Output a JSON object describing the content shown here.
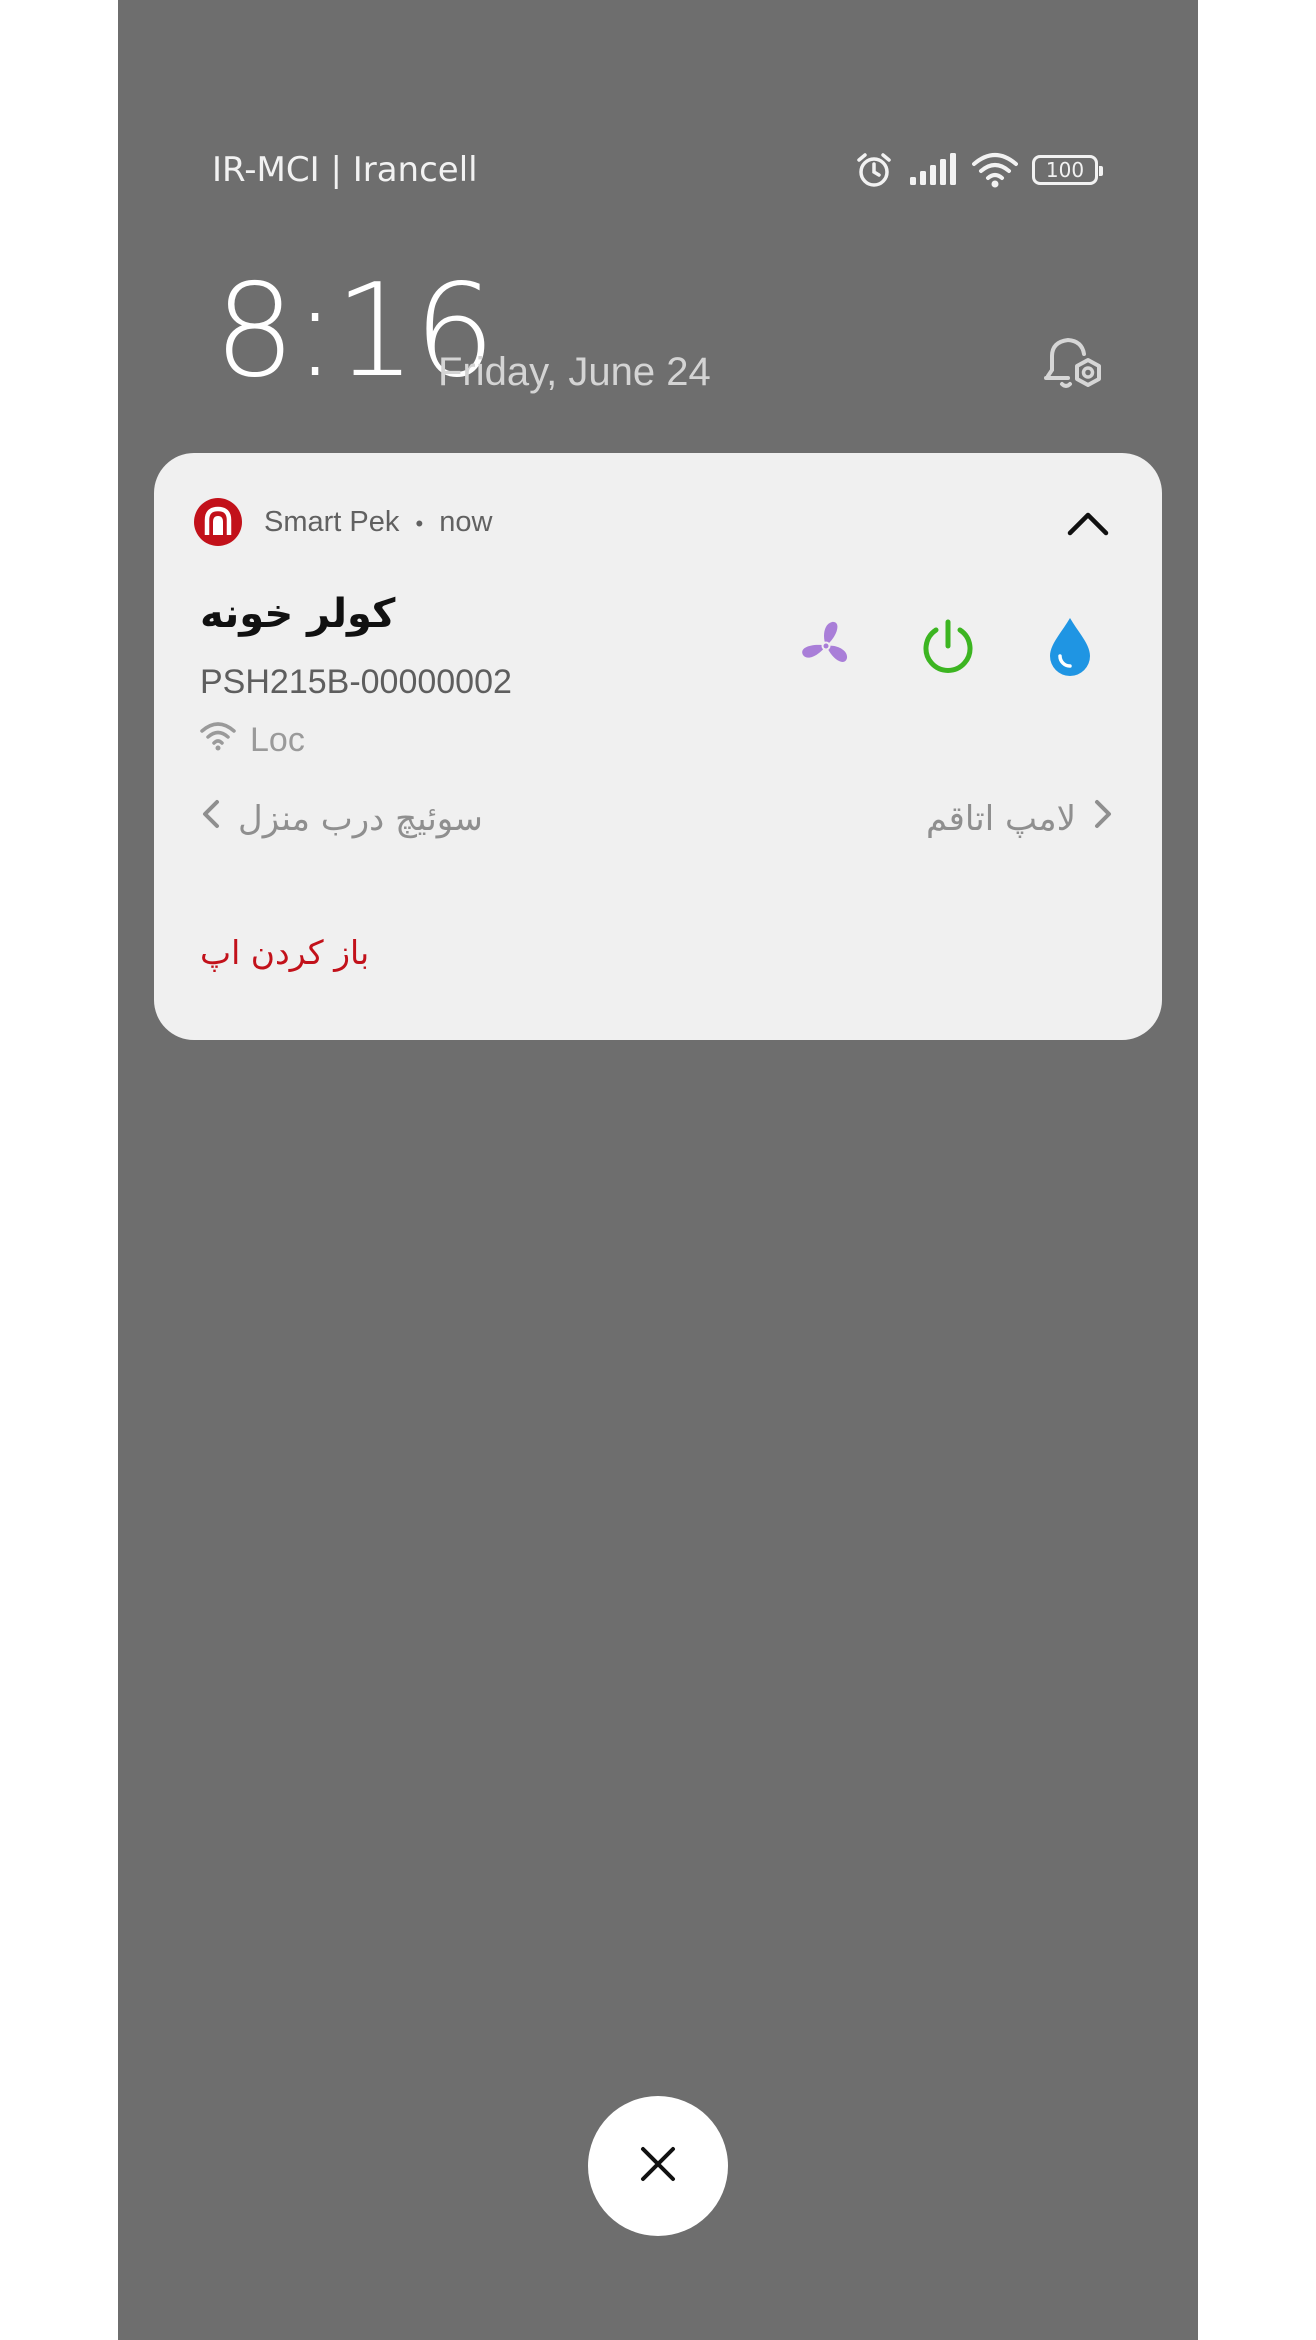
{
  "status_bar": {
    "carrier": "IR-MCI | Irancell",
    "battery": "100",
    "icons": [
      "alarm-icon",
      "signal-icon",
      "wifi-icon",
      "battery-icon"
    ]
  },
  "lockscreen": {
    "time": "8:16",
    "date": "Friday, June 24",
    "notification_settings_icon": "bell-gear-icon"
  },
  "notification": {
    "app_name": "Smart Pek",
    "time_label": "now",
    "separator": "•",
    "title": "کولر خونه",
    "device_id": "PSH215B-00000002",
    "connection": "Loc",
    "actions": [
      {
        "icon": "fan-icon",
        "color": "#a97ed8"
      },
      {
        "icon": "power-icon",
        "color": "#3cb521"
      },
      {
        "icon": "water-drop-icon",
        "color": "#1f95e3"
      }
    ],
    "prev_device": "سوئیچ درب منزل",
    "next_device": "لامپ اتاقم",
    "open_app": "باز کردن اپ",
    "brand_color": "#c2111a"
  },
  "close_button_icon": "close-icon"
}
